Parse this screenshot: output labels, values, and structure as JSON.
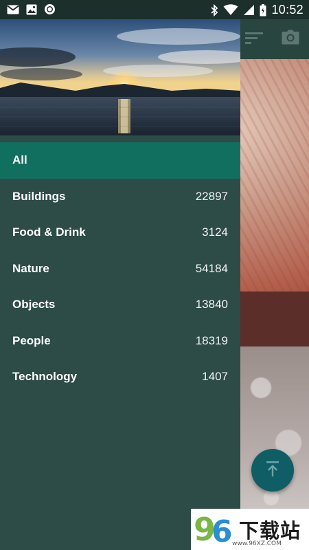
{
  "status_bar": {
    "time": "10:52",
    "icons_left": [
      "gmail-icon",
      "photo-icon",
      "record-icon"
    ],
    "icons_right": [
      "bluetooth-icon",
      "wifi-icon",
      "signal-icon",
      "battery-icon"
    ]
  },
  "toolbar": {
    "icons": [
      "sort-icon",
      "camera-icon"
    ]
  },
  "drawer": {
    "menu": [
      {
        "label": "All",
        "count": "",
        "active": true
      },
      {
        "label": "Buildings",
        "count": "22897"
      },
      {
        "label": "Food & Drink",
        "count": "3124"
      },
      {
        "label": "Nature",
        "count": "54184"
      },
      {
        "label": "Objects",
        "count": "13840"
      },
      {
        "label": "People",
        "count": "18319"
      },
      {
        "label": "Technology",
        "count": "1407"
      }
    ]
  },
  "fab": {
    "icon": "scroll-to-top-icon"
  },
  "watermark": {
    "logo_digits": "96",
    "text": "下载站",
    "url": "www.96XZ.COM"
  },
  "colors": {
    "drawer_bg": "#2d4b47",
    "active_item": "#116f5f",
    "status_bar": "#1c2f2b",
    "toolbar": "#29453f",
    "fab": "#0f5e66"
  }
}
